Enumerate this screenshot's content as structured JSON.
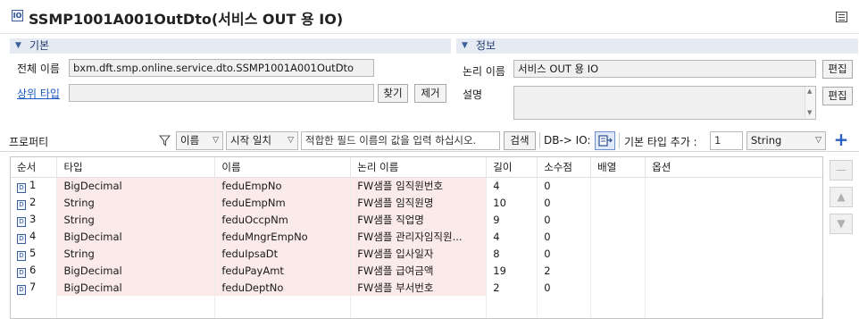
{
  "header": {
    "icon_text": "IO",
    "title": "SSMP1001A001OutDto(서비스 OUT 용 IO)"
  },
  "basic": {
    "section_label": "기본",
    "fullname_label": "전체 이름",
    "fullname_value": "bxm.dft.smp.online.service.dto.SSMP1001A001OutDto",
    "parent_label": "상위 타입",
    "parent_value": "",
    "find_btn": "찾기",
    "remove_btn": "제거"
  },
  "info": {
    "section_label": "정보",
    "logical_label": "논리 이름",
    "logical_value": "서비스 OUT 용 IO",
    "desc_label": "설명",
    "desc_value": "",
    "edit_btn": "편집"
  },
  "toolbar": {
    "property_label": "프로퍼티",
    "filter_field": "이름",
    "match_mode": "시작 일치",
    "search_placeholder": "적합한 필드 이름의 값을 입력 하십시오.",
    "search_btn": "검색",
    "db_io_label": "DB-> IO:",
    "add_basic_type_label": "기본 타입 추가 :",
    "count_value": "1",
    "type_select": "String"
  },
  "table": {
    "columns": [
      "순서",
      "타입",
      "이름",
      "논리 이름",
      "길이",
      "소수점",
      "배열",
      "옵션"
    ],
    "rows": [
      {
        "seq": "1",
        "type": "BigDecimal",
        "name": "feduEmpNo",
        "logical": "FW샘플 임직원번호",
        "len": "4",
        "dec": "0",
        "arr": "",
        "opt": ""
      },
      {
        "seq": "2",
        "type": "String",
        "name": "feduEmpNm",
        "logical": "FW샘플 임직원명",
        "len": "10",
        "dec": "0",
        "arr": "",
        "opt": ""
      },
      {
        "seq": "3",
        "type": "String",
        "name": "feduOccpNm",
        "logical": "FW샘플 직업명",
        "len": "9",
        "dec": "0",
        "arr": "",
        "opt": ""
      },
      {
        "seq": "4",
        "type": "BigDecimal",
        "name": "feduMngrEmpNo",
        "logical": "FW샘플 관리자임직원...",
        "len": "4",
        "dec": "0",
        "arr": "",
        "opt": ""
      },
      {
        "seq": "5",
        "type": "String",
        "name": "feduIpsaDt",
        "logical": "FW샘플 입사일자",
        "len": "8",
        "dec": "0",
        "arr": "",
        "opt": ""
      },
      {
        "seq": "6",
        "type": "BigDecimal",
        "name": "feduPayAmt",
        "logical": "FW샘플 급여금액",
        "len": "19",
        "dec": "2",
        "arr": "",
        "opt": ""
      },
      {
        "seq": "7",
        "type": "BigDecimal",
        "name": "feduDeptNo",
        "logical": "FW샘플 부서번호",
        "len": "2",
        "dec": "0",
        "arr": "",
        "opt": ""
      }
    ]
  }
}
